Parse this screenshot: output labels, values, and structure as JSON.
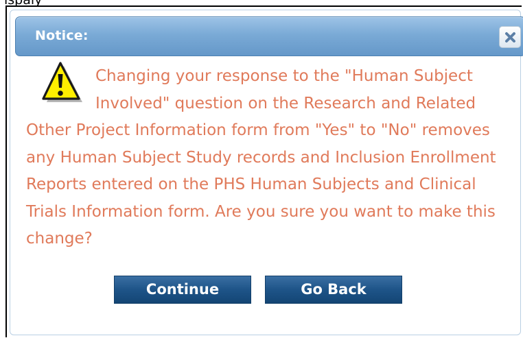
{
  "header_fragment": "ispaly",
  "dialog": {
    "title": "Notice:",
    "close_icon": "close-icon",
    "warning_icon": "warning-icon",
    "message": "Changing your response to the \"Human Subject Involved\" question on the Research and Related Other Project Information form from \"Yes\" to \"No\" removes any Human Subject Study records and Inclusion Enrollment Reports entered on the PHS Human Subjects and Clinical Trials Information form. Are you sure you want to make this change?",
    "buttons": {
      "continue_label": "Continue",
      "go_back_label": "Go Back"
    }
  },
  "colors": {
    "titlebar": "#7aaad6",
    "message_text": "#e07a5a",
    "button": "#1e5488",
    "warning_fill": "#ffee00"
  }
}
